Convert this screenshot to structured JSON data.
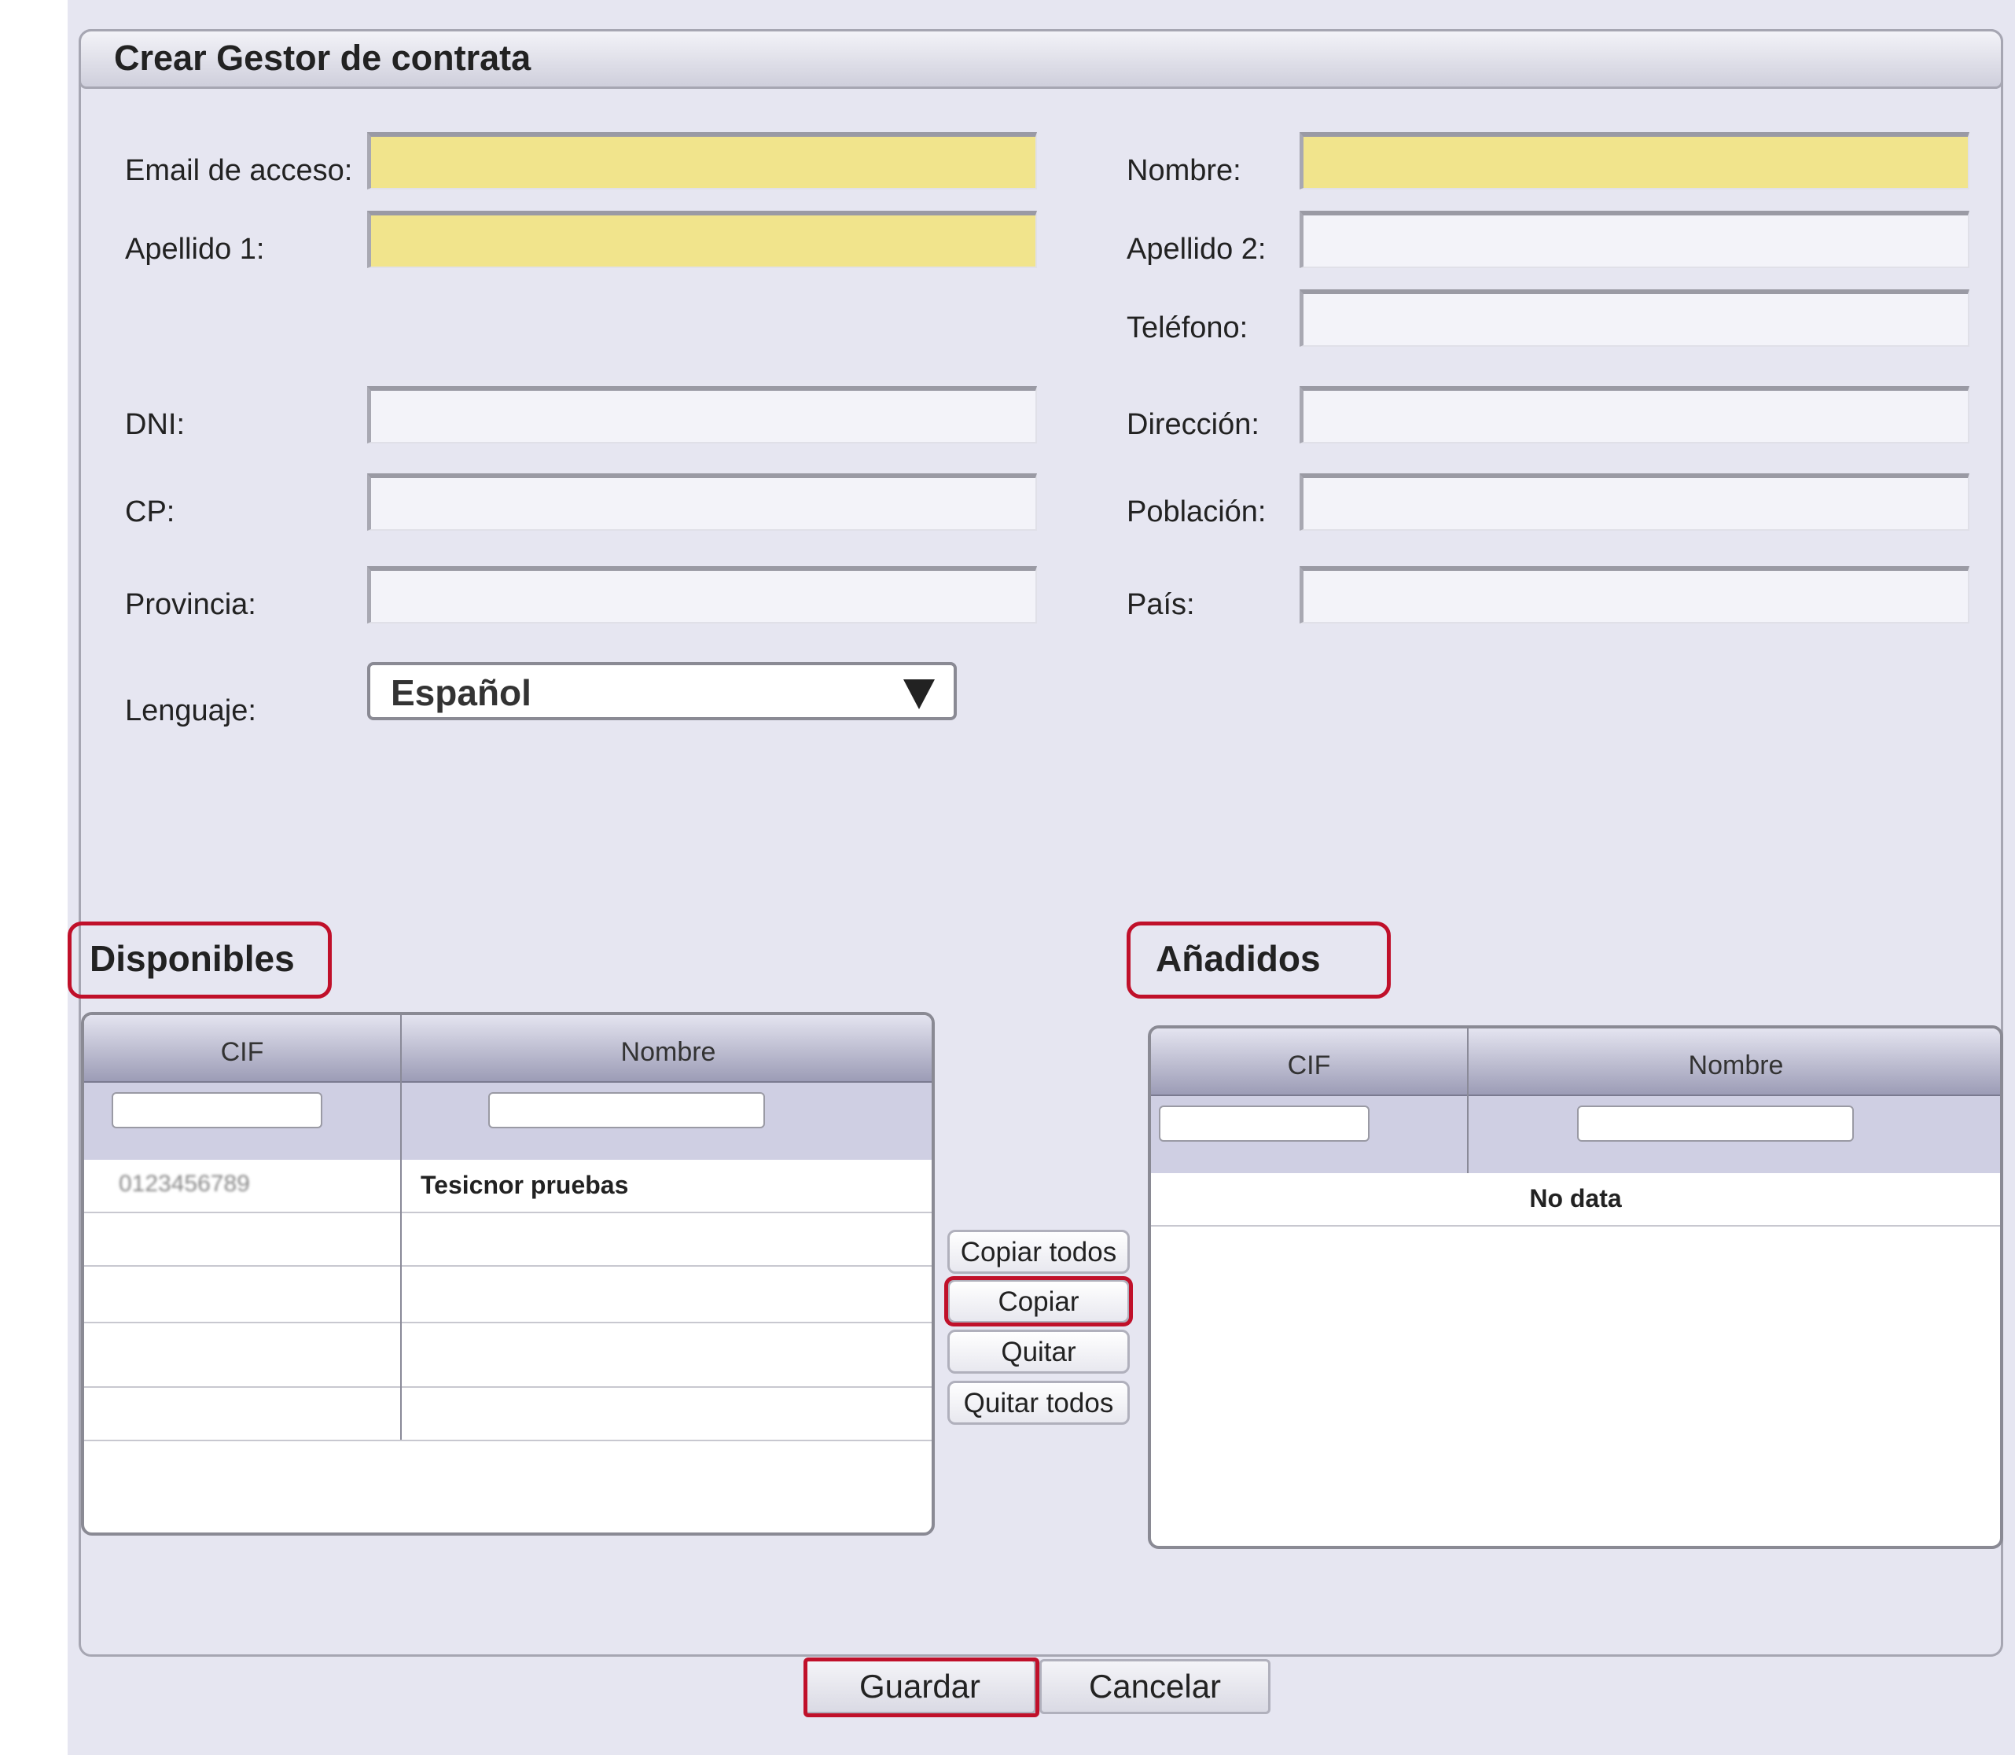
{
  "form": {
    "title": "Crear Gestor de contrata",
    "labels": {
      "email": "Email de acceso:",
      "apellido1": "Apellido 1:",
      "dni": "DNI:",
      "cp": "CP:",
      "provincia": "Provincia:",
      "lenguaje": "Lenguaje:",
      "nombre": "Nombre:",
      "apellido2": "Apellido 2:",
      "telefono": "Teléfono:",
      "direccion": "Dirección:",
      "poblacion": "Población:",
      "pais": "País:"
    },
    "values": {
      "email": "",
      "apellido1": "",
      "dni": "",
      "cp": "",
      "provincia": "",
      "nombre": "",
      "apellido2": "",
      "telefono": "",
      "direccion": "",
      "poblacion": "",
      "pais": ""
    },
    "language_selected": "Español"
  },
  "disponibles": {
    "title": "Disponibles",
    "columns": [
      "CIF",
      "Nombre"
    ],
    "rows": [
      {
        "cif": "0123456789",
        "nombre": "Tesicnor pruebas"
      }
    ]
  },
  "anadidos": {
    "title": "Añadidos",
    "columns": [
      "CIF",
      "Nombre"
    ],
    "empty_text": "No data"
  },
  "transfer_buttons": {
    "copiar_todos": "Copiar todos",
    "copiar": "Copiar",
    "quitar": "Quitar",
    "quitar_todos": "Quitar todos"
  },
  "actions": {
    "guardar": "Guardar",
    "cancelar": "Cancelar"
  },
  "colors": {
    "required_field": "#f1e48c",
    "highlight": "#c0102a",
    "background": "#e6e6f1"
  }
}
